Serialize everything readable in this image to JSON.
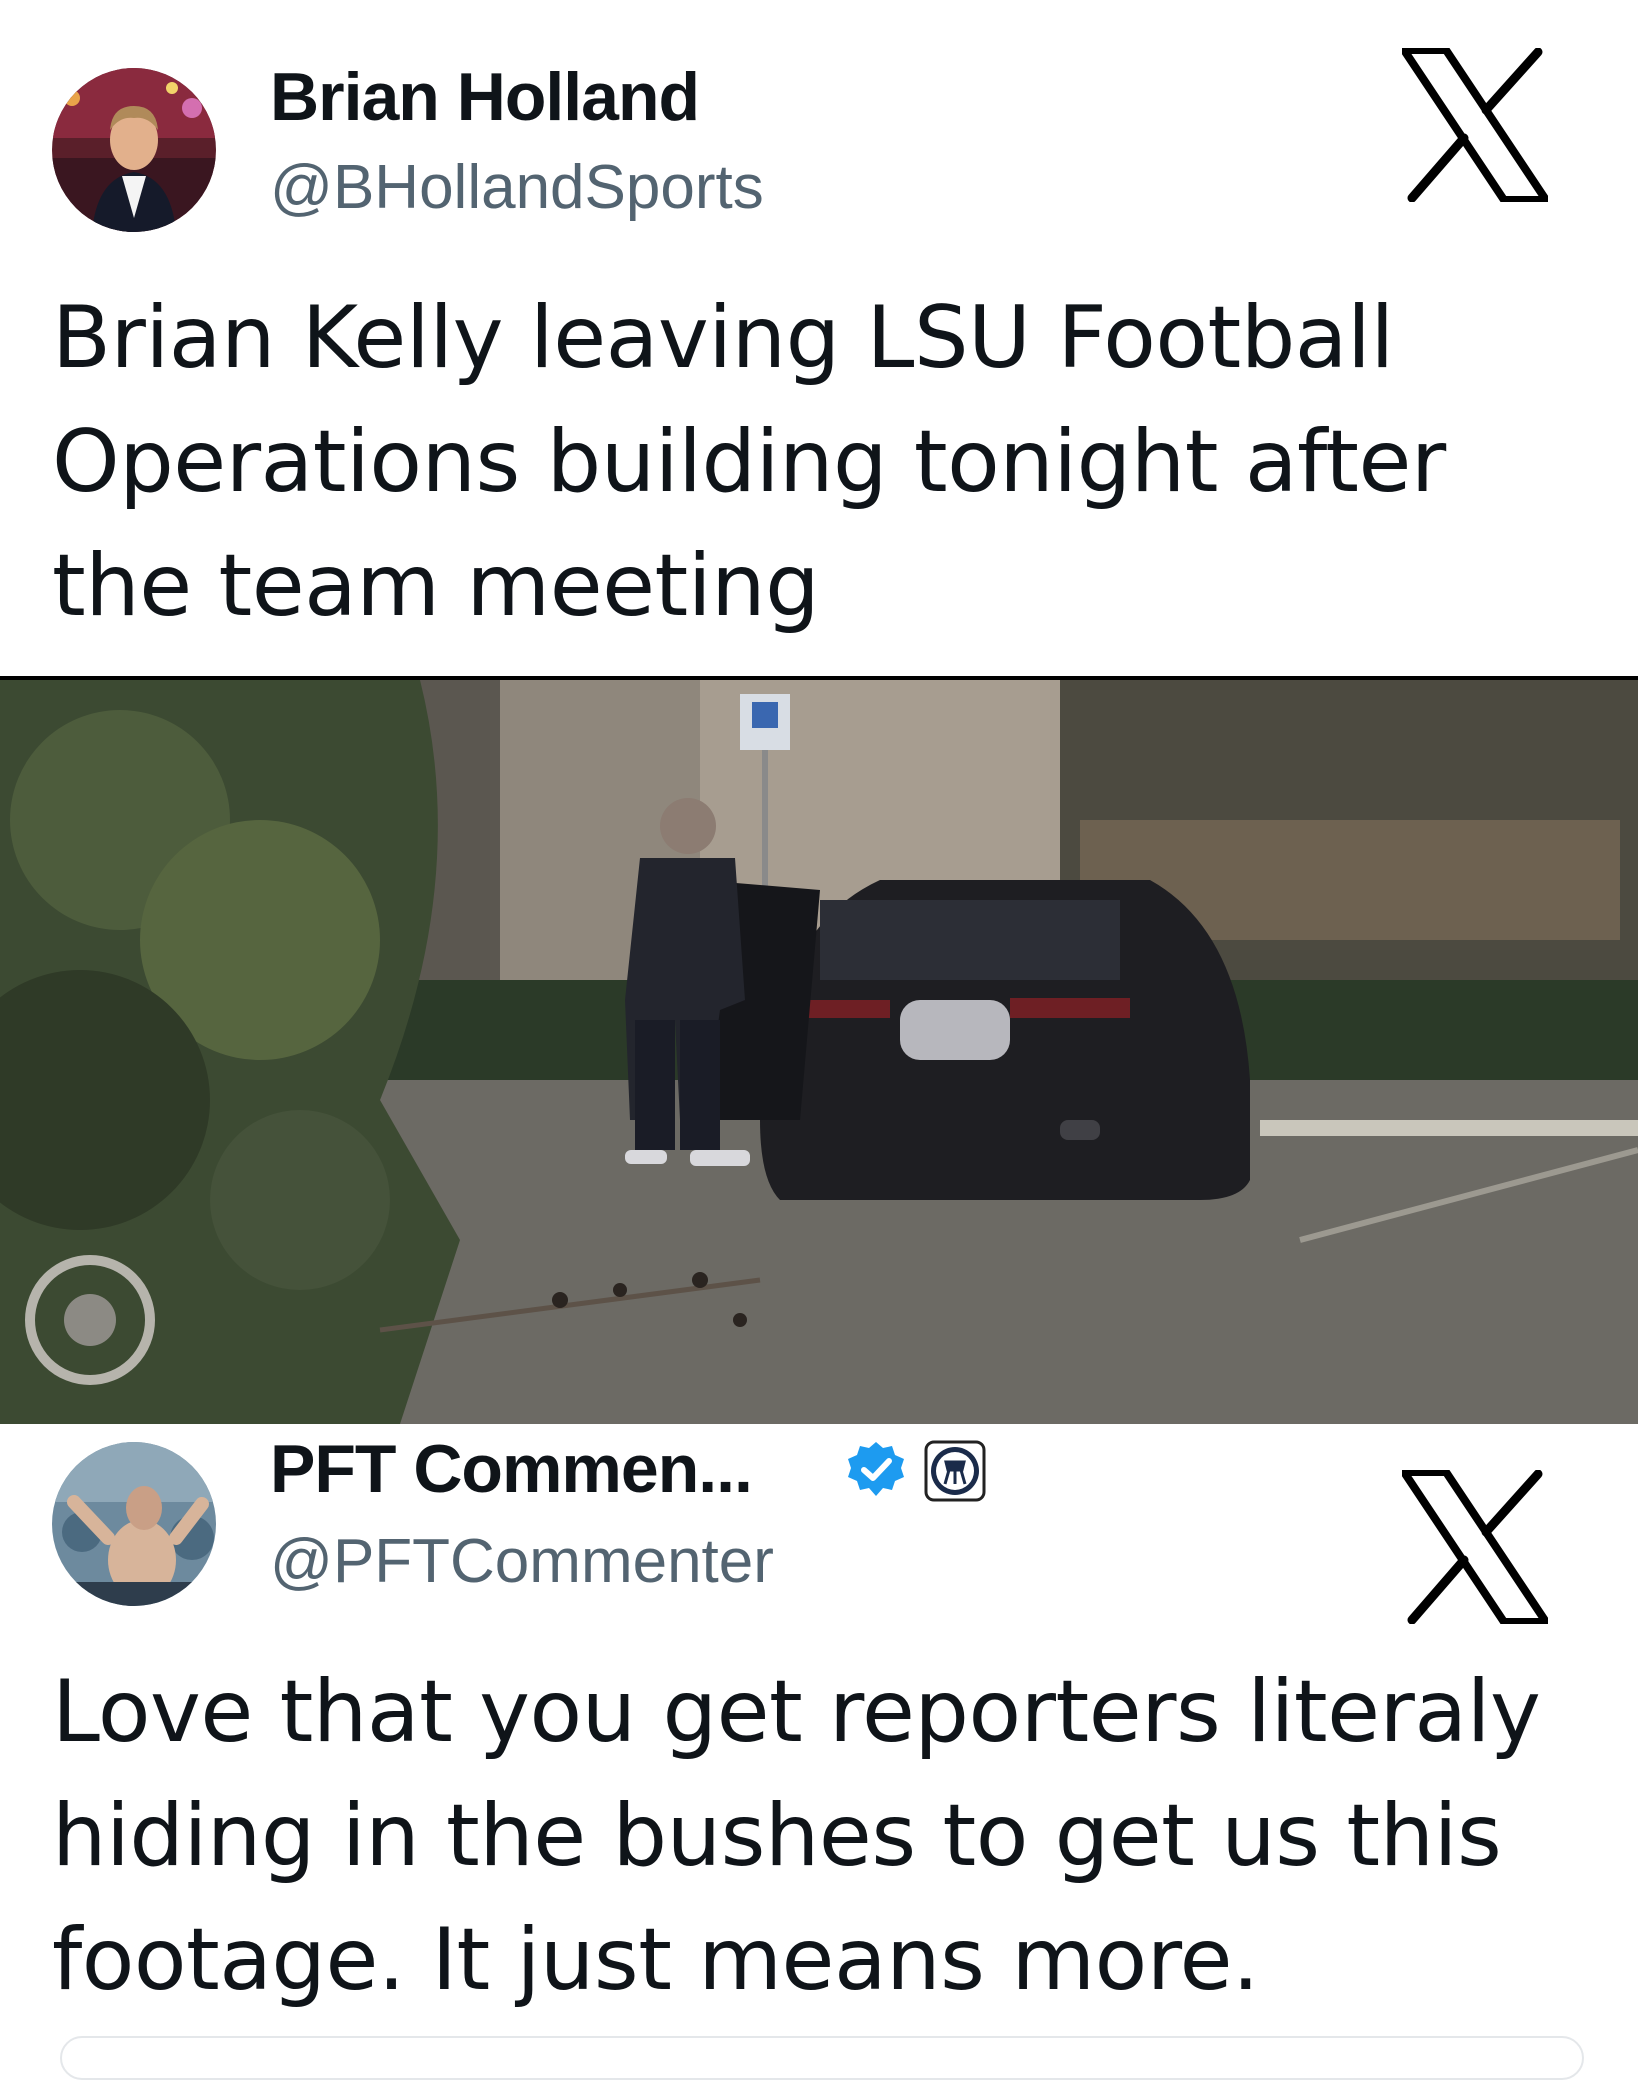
{
  "tweet1": {
    "name": "Brian Holland",
    "handle": "@BHollandSports",
    "body_lines": [
      "Brian Kelly leaving LSU Football",
      "Operations building tonight after",
      "the team meeting"
    ]
  },
  "tweet2": {
    "name": "PFT Commen...",
    "handle": "@PFTCommenter",
    "body_lines": [
      "Love that you get reporters literaly",
      "hiding in the bushes to get us this",
      "footage. It just means more."
    ]
  },
  "icons": {
    "platform_logo": "x-logo-icon",
    "verified": "verified-badge-icon",
    "affiliate": "barstool-affiliate-icon"
  },
  "colors": {
    "text": "#0f1419",
    "handle": "#536471",
    "verified": "#1d9bf0"
  }
}
